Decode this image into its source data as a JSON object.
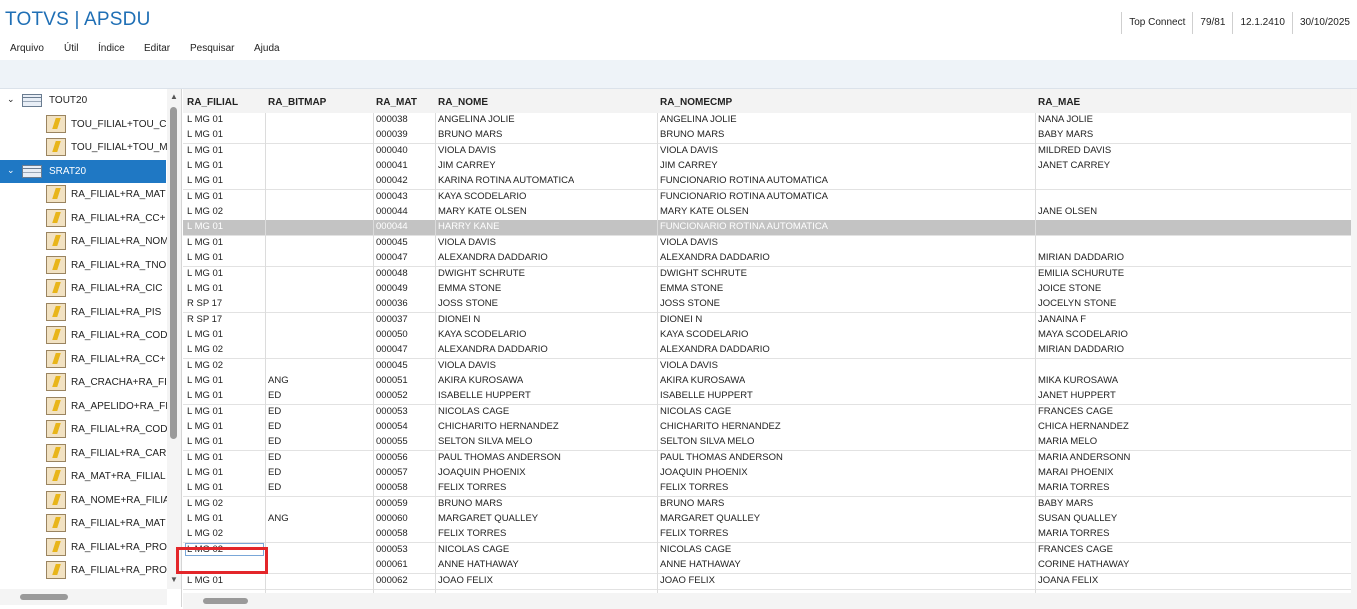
{
  "app": {
    "title": "TOTVS | APSDU"
  },
  "status": [
    "Top Connect",
    "79/81",
    "12.1.2410",
    "30/10/2025"
  ],
  "menu": [
    "Arquivo",
    "Útil",
    "Índice",
    "Editar",
    "Pesquisar",
    "Ajuda"
  ],
  "tree": {
    "root1": "TOUT20",
    "root1_children": [
      "TOU_FILIAL+TOU_C",
      "TOU_FILIAL+TOU_M"
    ],
    "root2": "SRAT20",
    "root2_children": [
      "RA_FILIAL+RA_MAT",
      "RA_FILIAL+RA_CC+",
      "RA_FILIAL+RA_NOM",
      "RA_FILIAL+RA_TNO",
      "RA_FILIAL+RA_CIC",
      "RA_FILIAL+RA_PIS",
      "RA_FILIAL+RA_COD",
      "RA_FILIAL+RA_CC+",
      "RA_CRACHA+RA_FI",
      "RA_APELIDO+RA_FI",
      "RA_FILIAL+RA_COD",
      "RA_FILIAL+RA_CAR",
      "RA_MAT+RA_FILIAL",
      "RA_NOME+RA_FILIA",
      "RA_FILIAL+RA_MAT",
      "RA_FILIAL+RA_PRO",
      "RA_FILIAL+RA_PRO"
    ]
  },
  "grid": {
    "columns": [
      "RA_FILIAL",
      "RA_BITMAP",
      "RA_MAT",
      "RA_NOME",
      "RA_NOMECMP",
      "RA_MAE"
    ],
    "selected_row": 7,
    "rows": [
      [
        "L MG 01",
        "",
        "000038",
        "ANGELINA JOLIE",
        "ANGELINA JOLIE",
        "NANA JOLIE"
      ],
      [
        "L MG 01",
        "",
        "000039",
        "BRUNO MARS",
        "BRUNO MARS",
        "BABY MARS"
      ],
      [
        "L MG 01",
        "",
        "000040",
        "VIOLA DAVIS",
        "VIOLA DAVIS",
        "MILDRED DAVIS"
      ],
      [
        "L MG 01",
        "",
        "000041",
        "JIM CARREY",
        "JIM CARREY",
        "JANET CARREY"
      ],
      [
        "L MG 01",
        "",
        "000042",
        "KARINA ROTINA AUTOMATICA",
        "FUNCIONARIO ROTINA AUTOMATICA",
        ""
      ],
      [
        "L MG 01",
        "",
        "000043",
        "KAYA SCODELARIO",
        "FUNCIONARIO ROTINA AUTOMATICA",
        ""
      ],
      [
        "L MG 02",
        "",
        "000044",
        "MARY KATE OLSEN",
        "MARY KATE OLSEN",
        "JANE OLSEN"
      ],
      [
        "L MG 01",
        "",
        "000044",
        "HARRY KANE",
        "FUNCIONARIO ROTINA AUTOMATICA",
        ""
      ],
      [
        "L MG 01",
        "",
        "000045",
        "VIOLA DAVIS",
        "VIOLA DAVIS",
        ""
      ],
      [
        "L MG 01",
        "",
        "000047",
        "ALEXANDRA DADDARIO",
        "ALEXANDRA DADDARIO",
        "MIRIAN DADDARIO"
      ],
      [
        "L MG 01",
        "",
        "000048",
        "DWIGHT SCHRUTE",
        "DWIGHT SCHRUTE",
        "EMILIA SCHURUTE"
      ],
      [
        "L MG 01",
        "",
        "000049",
        "EMMA STONE",
        "EMMA STONE",
        "JOICE STONE"
      ],
      [
        "R SP 17",
        "",
        "000036",
        "JOSS STONE",
        "JOSS STONE",
        "JOCELYN STONE"
      ],
      [
        "R SP 17",
        "",
        "000037",
        "DIONEI N",
        "DIONEI N",
        "JANAINA F"
      ],
      [
        "L MG 01",
        "",
        "000050",
        "KAYA SCODELARIO",
        "KAYA SCODELARIO",
        "MAYA SCODELARIO"
      ],
      [
        "L MG 02",
        "",
        "000047",
        "ALEXANDRA DADDARIO",
        "ALEXANDRA DADDARIO",
        "MIRIAN DADDARIO"
      ],
      [
        "L MG 02",
        "",
        "000045",
        "VIOLA DAVIS",
        "VIOLA DAVIS",
        ""
      ],
      [
        "L MG 01",
        "ANG",
        "000051",
        "AKIRA KUROSAWA",
        "AKIRA KUROSAWA",
        "MIKA KUROSAWA"
      ],
      [
        "L MG 01",
        "ED",
        "000052",
        "ISABELLE HUPPERT",
        "ISABELLE HUPPERT",
        "JANET HUPPERT"
      ],
      [
        "L MG 01",
        "ED",
        "000053",
        "NICOLAS CAGE",
        "NICOLAS CAGE",
        "FRANCES CAGE"
      ],
      [
        "L MG 01",
        "ED",
        "000054",
        "CHICHARITO HERNANDEZ",
        "CHICHARITO HERNANDEZ",
        "CHICA HERNANDEZ"
      ],
      [
        "L MG 01",
        "ED",
        "000055",
        "SELTON SILVA MELO",
        "SELTON SILVA MELO",
        "MARIA MELO"
      ],
      [
        "L MG 01",
        "ED",
        "000056",
        "PAUL THOMAS ANDERSON",
        "PAUL THOMAS ANDERSON",
        "MARIA ANDERSONN"
      ],
      [
        "L MG 01",
        "ED",
        "000057",
        "JOAQUIN PHOENIX",
        "JOAQUIN PHOENIX",
        "MARAI PHOENIX"
      ],
      [
        "L MG 01",
        "ED",
        "000058",
        "FELIX TORRES",
        "FELIX TORRES",
        "MARIA TORRES"
      ],
      [
        "L MG 02",
        "",
        "000059",
        "BRUNO MARS",
        "BRUNO MARS",
        "BABY MARS"
      ],
      [
        "L MG 01",
        "ANG",
        "000060",
        "MARGARET QUALLEY",
        "MARGARET QUALLEY",
        "SUSAN QUALLEY"
      ],
      [
        "L MG 02",
        "",
        "000058",
        "FELIX TORRES",
        "FELIX TORRES",
        "MARIA TORRES"
      ],
      [
        "L MG 02",
        "",
        "000053",
        "NICOLAS CAGE",
        "NICOLAS CAGE",
        "FRANCES CAGE"
      ],
      [
        "",
        "",
        "000061",
        "ANNE HATHAWAY",
        "ANNE HATHAWAY",
        "CORINE HATHAWAY"
      ],
      [
        "L MG 01",
        "",
        "000062",
        "JOAO FELIX",
        "JOAO FELIX",
        "JOANA FELIX"
      ]
    ]
  }
}
